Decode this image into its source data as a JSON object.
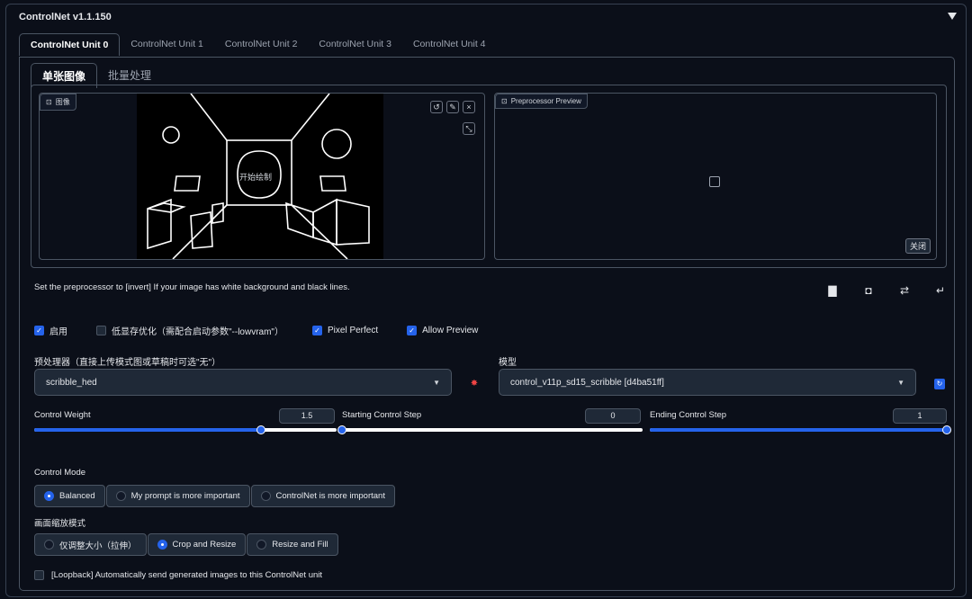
{
  "header": {
    "title": "ControlNet v1.1.150"
  },
  "tabs": [
    {
      "label": "ControlNet Unit 0",
      "active": true
    },
    {
      "label": "ControlNet Unit 1",
      "active": false
    },
    {
      "label": "ControlNet Unit 2",
      "active": false
    },
    {
      "label": "ControlNet Unit 3",
      "active": false
    },
    {
      "label": "ControlNet Unit 4",
      "active": false
    }
  ],
  "subtabs": [
    {
      "label": "单张图像",
      "active": true
    },
    {
      "label": "批量处理",
      "active": false
    }
  ],
  "image_box": {
    "label": "图像",
    "canvas_hint": "开始绘制"
  },
  "preview_box": {
    "label": "Preprocessor Preview",
    "close_label": "关闭"
  },
  "hint": "Set the preprocessor to [invert] If your image has white background and black lines.",
  "checks": [
    {
      "label": "启用",
      "checked": true
    },
    {
      "label": "低显存优化（需配合启动参数\"--lowvram\"）",
      "checked": false
    },
    {
      "label": "Pixel Perfect",
      "checked": true
    },
    {
      "label": "Allow Preview",
      "checked": true
    }
  ],
  "preprocessor": {
    "label": "预处理器（直接上传模式图或草稿时可选\"无\"）",
    "value": "scribble_hed"
  },
  "model": {
    "label": "模型",
    "value": "control_v11p_sd15_scribble [d4ba51ff]"
  },
  "sliders": [
    {
      "label": "Control Weight",
      "value": "1.5",
      "fraction": 0.75
    },
    {
      "label": "Starting Control Step",
      "value": "0",
      "fraction": 0.0
    },
    {
      "label": "Ending Control Step",
      "value": "1",
      "fraction": 1.0
    }
  ],
  "control_mode": {
    "label": "Control Mode",
    "options": [
      {
        "label": "Balanced",
        "selected": true
      },
      {
        "label": "My prompt is more important",
        "selected": false
      },
      {
        "label": "ControlNet is more important",
        "selected": false
      }
    ]
  },
  "resize_mode": {
    "label": "画面缩放模式",
    "options": [
      {
        "label": "仅调整大小（拉伸）",
        "selected": false
      },
      {
        "label": "Crop and Resize",
        "selected": true
      },
      {
        "label": "Resize and Fill",
        "selected": false
      }
    ]
  },
  "loopback": {
    "label": "[Loopback] Automatically send generated images to this ControlNet unit",
    "checked": false
  },
  "colors": {
    "accent": "#2563eb",
    "background": "#0b0f19",
    "panel": "#1f2937",
    "border": "#4b5563",
    "danger": "#ef4444"
  },
  "icons": [
    "undo-icon",
    "edit-icon",
    "close-icon",
    "resize-icon",
    "image-icon",
    "new-canvas-icon",
    "camera-icon",
    "swap-icon",
    "send-dimensions-icon",
    "refresh-icon"
  ]
}
